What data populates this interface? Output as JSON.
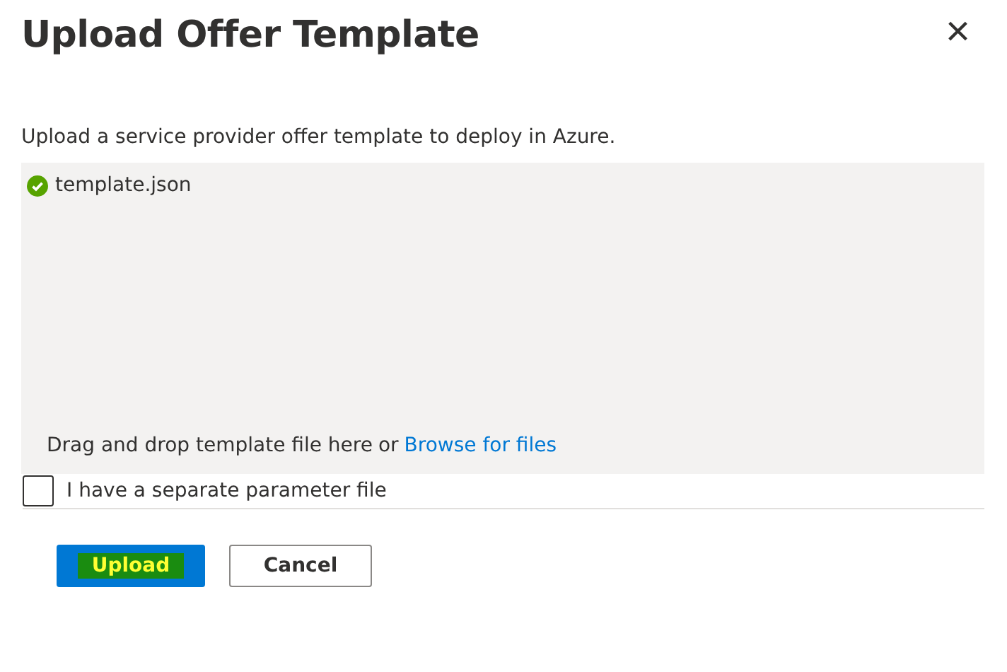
{
  "dialog": {
    "title": "Upload Offer Template",
    "close": "×"
  },
  "description": "Upload a service provider offer template to deploy in Azure.",
  "dropzone": {
    "files": [
      {
        "name": "template.json",
        "uploaded": true
      }
    ],
    "hint": "Drag and drop template file here",
    "or": "or",
    "browse_link": "Browse for files"
  },
  "parameter_checkbox": {
    "label": "I have a separate parameter file",
    "checked": false
  },
  "buttons": [
    {
      "label": "Upload",
      "kind": "primary",
      "highlighted": true
    },
    {
      "label": "Cancel",
      "kind": "secondary",
      "highlighted": false
    }
  ]
}
